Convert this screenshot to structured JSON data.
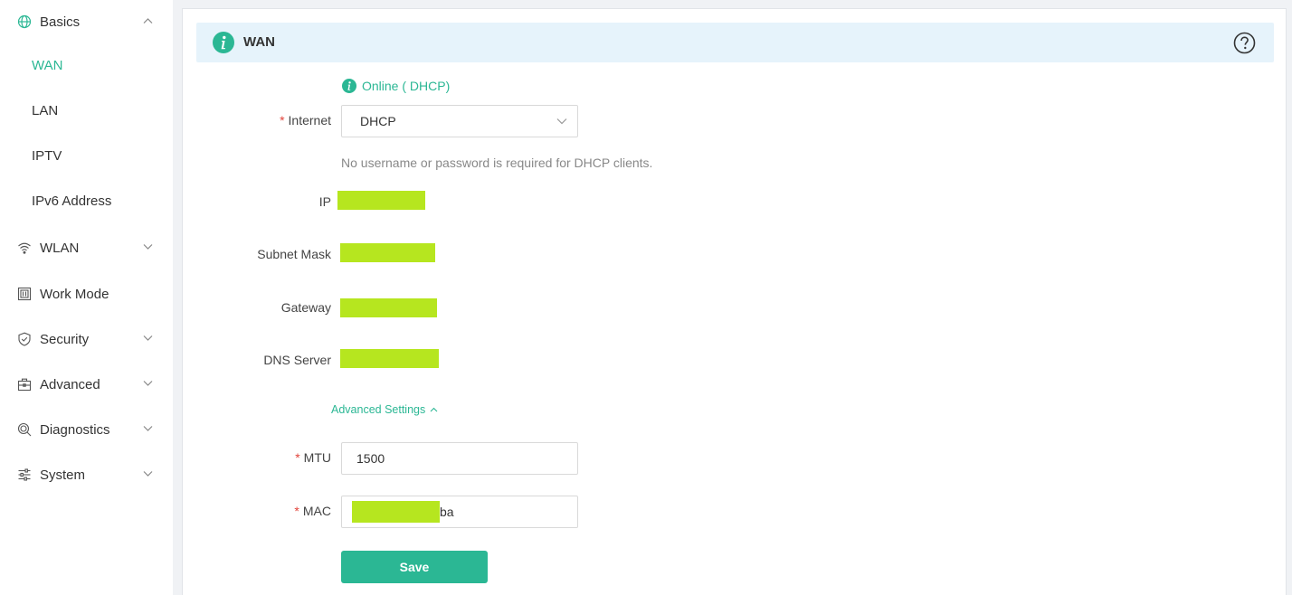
{
  "sidebar": {
    "basics": {
      "label": "Basics",
      "icon": "globe-icon",
      "expanded": true
    },
    "sub_items": [
      {
        "label": "WAN",
        "active": true
      },
      {
        "label": "LAN",
        "active": false
      },
      {
        "label": "IPTV",
        "active": false
      },
      {
        "label": "IPv6 Address",
        "active": false
      }
    ],
    "items": [
      {
        "label": "WLAN",
        "icon": "wifi-icon"
      },
      {
        "label": "Work Mode",
        "icon": "work-mode-icon"
      },
      {
        "label": "Security",
        "icon": "shield-icon"
      },
      {
        "label": "Advanced",
        "icon": "toolbox-icon"
      },
      {
        "label": "Diagnostics",
        "icon": "diagnostics-icon"
      },
      {
        "label": "System",
        "icon": "sliders-icon"
      }
    ]
  },
  "header": {
    "title": "WAN",
    "info_icon": "info-icon",
    "help_icon": "help-icon"
  },
  "status": {
    "text": "Online ( DHCP)"
  },
  "form": {
    "internet": {
      "label": "Internet",
      "value": "DHCP"
    },
    "hint": "No username or password is required for DHCP clients.",
    "ip_label": "IP",
    "subnet_label": "Subnet Mask",
    "gateway_label": "Gateway",
    "dns_label": "DNS Server",
    "advanced_label": "Advanced Settings",
    "mtu": {
      "label": "MTU",
      "value": "1500"
    },
    "mac": {
      "label": "MAC",
      "value_visible_suffix": "ba"
    },
    "required_mark": "*"
  },
  "save_button": {
    "label": "Save"
  },
  "colors": {
    "accent": "#2bb794",
    "redaction": "#b6e61f",
    "required": "#e2453c",
    "header_bg": "#e6f3fb"
  }
}
